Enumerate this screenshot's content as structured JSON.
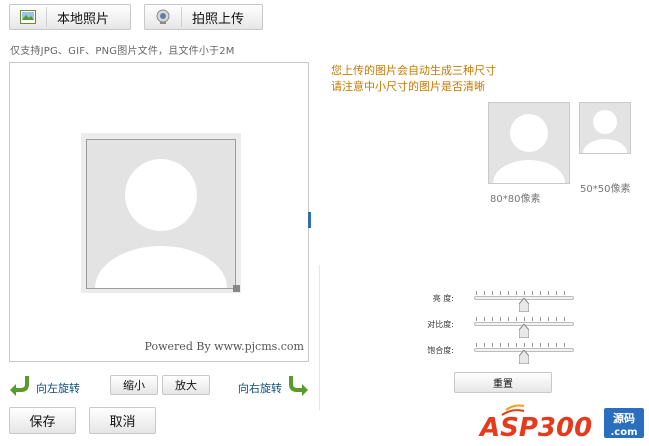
{
  "tabs": {
    "local_photo": "本地照片",
    "take_photo": "拍照上传"
  },
  "hint": "仅支持JPG、GIF、PNG图片文件，且文件小于2M",
  "editor": {
    "powered_by": "Powered By www.pjcms.com"
  },
  "controls": {
    "rotate_left": "向左旋转",
    "zoom_out": "缩小",
    "zoom_in": "放大",
    "rotate_right": "向右旋转",
    "save": "保存",
    "cancel": "取消"
  },
  "notice": {
    "line1": "您上传的图片会自动生成三种尺寸",
    "line2": "请注意中小尺寸的图片是否清晰"
  },
  "previews": {
    "large_caption": "80*80像素",
    "small_caption": "50*50像素"
  },
  "sliders": [
    {
      "label": "亮  度:",
      "value": 0.5
    },
    {
      "label": "对比度:",
      "value": 0.5
    },
    {
      "label": "饱合度:",
      "value": 0.5
    }
  ],
  "reset_label": "重置",
  "watermark": {
    "brand": "ASP300",
    "sub1": "源码",
    "sub2": ".com"
  },
  "colors": {
    "notice": "#c27a00",
    "rotate_arrow": "#5a9a2a",
    "placeholder_bg": "#e3e3e3",
    "watermark_red": "#e63a1c"
  }
}
